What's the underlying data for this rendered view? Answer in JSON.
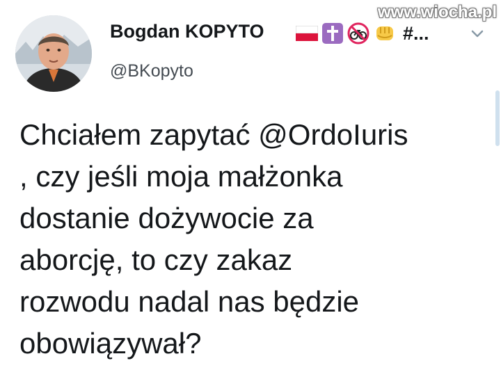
{
  "watermark": "www.wiocha.pl",
  "author": {
    "display_name": "Bogdan KOPYTO",
    "handle": "@BKopyto",
    "name_suffix": "#...",
    "name_emojis": [
      "poland-flag-icon",
      "latin-cross-icon",
      "no-bicycles-icon",
      "oncoming-fist-icon"
    ]
  },
  "tweet": {
    "lines": [
      "Chciałem zapytać @OrdoIuris",
      ", czy jeśli moja małżonka",
      "dostanie dożywocie za",
      "aborcję, to czy zakaz",
      "rozwodu nadal nas będzie",
      "obowiązywał?"
    ]
  },
  "colors": {
    "background": "#ffffff",
    "text": "#14171a",
    "handle": "#444b52",
    "flag_red": "#dc143c",
    "cross_purple": "#9b6bc0",
    "fist_yellow": "#f7c948"
  }
}
